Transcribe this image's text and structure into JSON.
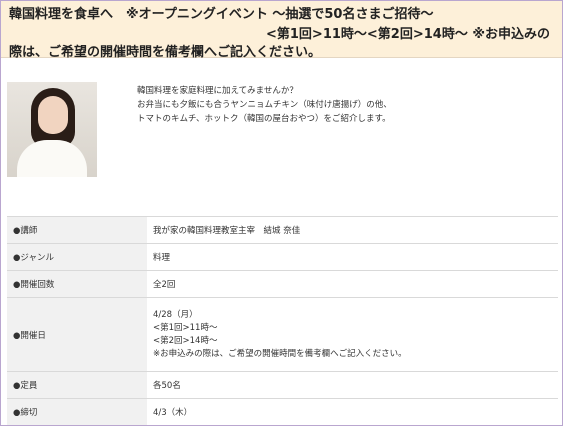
{
  "banner": {
    "line1": "韓国料理を食卓へ　※オープニングイベント ～抽選で50名さまご招待～",
    "line2": "<第1回>11時～<第2回>14時～ ※お申込みの",
    "line3": "際は、ご希望の開催時間を備考欄へご記入ください。"
  },
  "intro": {
    "lines": [
      "韓国料理を家庭料理に加えてみませんか？",
      "お弁当にも夕飯にも合うヤンニョムチキン（味付け唐揚げ）の他、",
      "トマトのキムチ、ホットク（韓国の屋台おやつ）をご紹介します。"
    ]
  },
  "info": {
    "rows": [
      {
        "label": "●講師",
        "value": "我が家の韓国料理教室主宰　結城 奈佳"
      },
      {
        "label": "●ジャンル",
        "value": "料理"
      },
      {
        "label": "●開催回数",
        "value": "全2回"
      },
      {
        "label": "●開催日",
        "lines": [
          "4/28（月）",
          "<第1回>11時～",
          "<第2回>14時～",
          "※お申込みの際は、ご希望の開催時間を備考欄へご記入ください。"
        ]
      },
      {
        "label": "●定員",
        "value": "各50名"
      },
      {
        "label": "●締切",
        "value": "4/3（木）"
      }
    ]
  }
}
